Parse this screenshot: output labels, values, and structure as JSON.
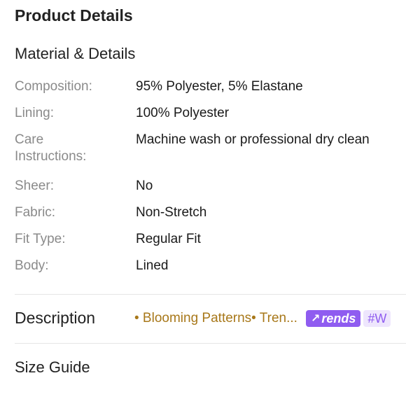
{
  "header": {
    "title": "Product Details"
  },
  "material": {
    "title": "Material & Details",
    "specs": [
      {
        "label": "Composition:",
        "value": "95% Polyester, 5% Elastane"
      },
      {
        "label": "Lining:",
        "value": "100% Polyester"
      },
      {
        "label": "Care Instructions:",
        "value": "Machine wash or professional dry clean"
      },
      {
        "label": "Sheer:",
        "value": "No"
      },
      {
        "label": "Fabric:",
        "value": "Non-Stretch"
      },
      {
        "label": "Fit Type:",
        "value": "Regular Fit"
      },
      {
        "label": "Body:",
        "value": "Lined"
      }
    ]
  },
  "description": {
    "title": "Description",
    "tags_text": "• Blooming Patterns• Tren...",
    "badge_label": "rends",
    "hashtag": "#W"
  },
  "size_guide": {
    "title": "Size Guide"
  },
  "colors": {
    "tag_gold": "#a8781a",
    "badge_purple": "#8f5cf0",
    "label_gray": "#8a8a8a"
  }
}
